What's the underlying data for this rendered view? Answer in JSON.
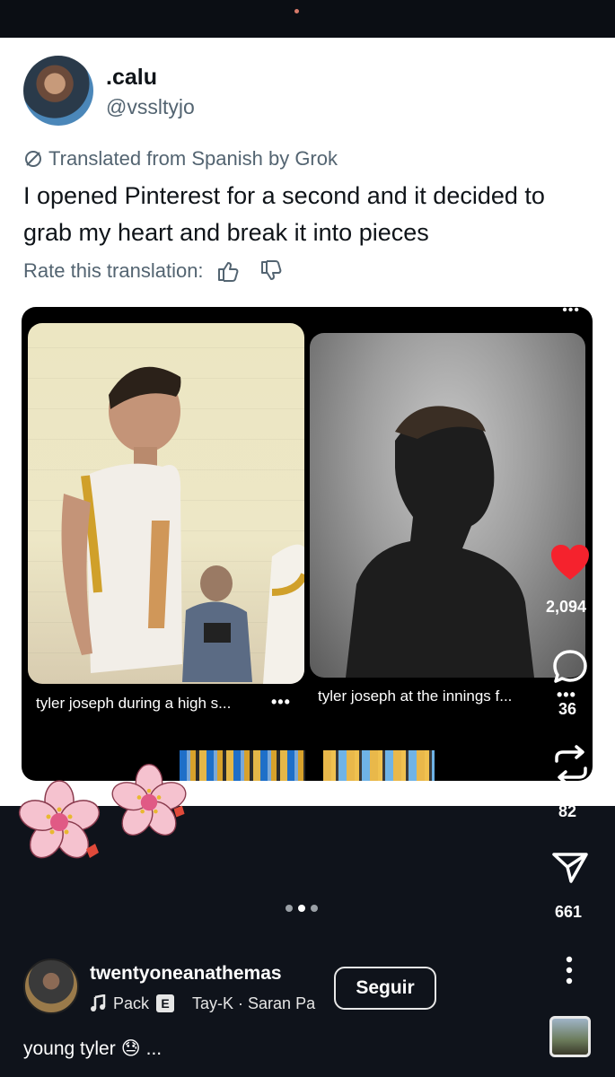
{
  "tweet": {
    "display_name": ".calu",
    "handle": "@vssltyjo",
    "translated_label": "Translated from Spanish by Grok",
    "body": "I opened Pinterest for a second and it decided to grab my heart and break it into pieces",
    "rate_label": "Rate this translation:",
    "media": {
      "caption_left": "tyler joseph during a high s...",
      "caption_right": "tyler joseph at the innings f...",
      "more_dots": "•••"
    }
  },
  "actions": {
    "likes": "2,094",
    "comments": "36",
    "reposts": "82",
    "shares": "661",
    "heart_color": "#f5222d"
  },
  "pager": {
    "count": 3,
    "active": 1
  },
  "post": {
    "username": "twentyoneanathemas",
    "music_track": "Pack",
    "explicit_badge": "E",
    "music_artist": "Tay-K · Saran Pa",
    "follow_label": "Seguir",
    "caption_text": "young tyler",
    "caption_emoji": "😓",
    "caption_more": "..."
  },
  "icons": {
    "translate": "translate-slash-icon",
    "thumbs_up": "thumbs-up-icon",
    "thumbs_down": "thumbs-down-icon",
    "heart": "heart-icon",
    "comment": "comment-bubble-icon",
    "repost": "repost-icon",
    "share": "send-arrow-icon",
    "more": "more-vertical-icon",
    "music": "music-note-icon"
  }
}
